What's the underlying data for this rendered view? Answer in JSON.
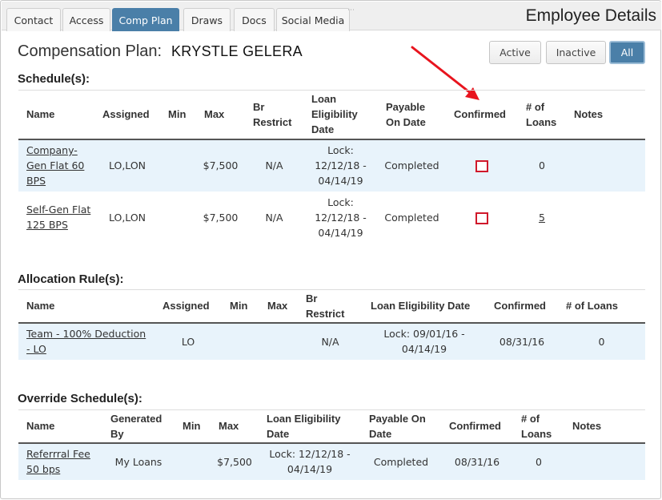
{
  "tabs": [
    {
      "label": "Contact"
    },
    {
      "label": "Access"
    },
    {
      "label": "Comp Plan"
    },
    {
      "label": "Draws"
    },
    {
      "label": "Docs"
    },
    {
      "label": "Social Media"
    }
  ],
  "header": {
    "title": "Employee Details"
  },
  "comp_plan": {
    "title": "Compensation Plan:",
    "employee_name": "KRYSTLE GELERA"
  },
  "filters": [
    {
      "label": "Active"
    },
    {
      "label": "Inactive"
    },
    {
      "label": "All"
    }
  ],
  "selected_filter": "All",
  "accent_color": "#4a7fa8",
  "annotation_color": "#e8141e",
  "schedules": {
    "title": "Schedule(s):",
    "columns": [
      "Name",
      "Assigned",
      "Min",
      "Max",
      "Br Restrict",
      "Loan Eligibility Date",
      "Payable On Date",
      "Confirmed",
      "# of Loans",
      "Notes"
    ],
    "rows": [
      {
        "name": "Company-Gen Flat 60 BPS",
        "assigned": "LO,LON",
        "min": "",
        "max": "$7,500",
        "br_restrict": "N/A",
        "loan_eligibility": "Lock: 12/12/18 - 04/14/19",
        "payable_on": "Completed",
        "confirmed": false,
        "loans": "0",
        "notes": ""
      },
      {
        "name": "Self-Gen Flat 125 BPS",
        "assigned": "LO,LON",
        "min": "",
        "max": "$7,500",
        "br_restrict": "N/A",
        "loan_eligibility": "Lock: 12/12/18 - 04/14/19",
        "payable_on": "Completed",
        "confirmed": false,
        "loans": "5",
        "notes": ""
      }
    ]
  },
  "allocation_rules": {
    "title": "Allocation Rule(s):",
    "columns": [
      "Name",
      "Assigned",
      "Min",
      "Max",
      "Br Restrict",
      "Loan Eligibility Date",
      "Confirmed",
      "# of Loans"
    ],
    "rows": [
      {
        "name": "Team - 100% Deduction - LO",
        "assigned": "LO",
        "min": "",
        "max": "",
        "br_restrict": "N/A",
        "loan_eligibility": "Lock: 09/01/16 - 04/14/19",
        "confirmed": "08/31/16",
        "loans": "0"
      }
    ]
  },
  "override_schedules": {
    "title": "Override Schedule(s):",
    "columns": [
      "Name",
      "Generated By",
      "Min",
      "Max",
      "Loan Eligibility Date",
      "Payable On Date",
      "Confirmed",
      "# of Loans",
      "Notes"
    ],
    "rows": [
      {
        "name": "Referrral Fee 50 bps",
        "generated_by": "My Loans",
        "min": "",
        "max": "$7,500",
        "loan_eligibility": "Lock: 12/12/18 - 04/14/19",
        "payable_on": "Completed",
        "confirmed": "08/31/16",
        "loans": "0",
        "notes": ""
      }
    ]
  }
}
